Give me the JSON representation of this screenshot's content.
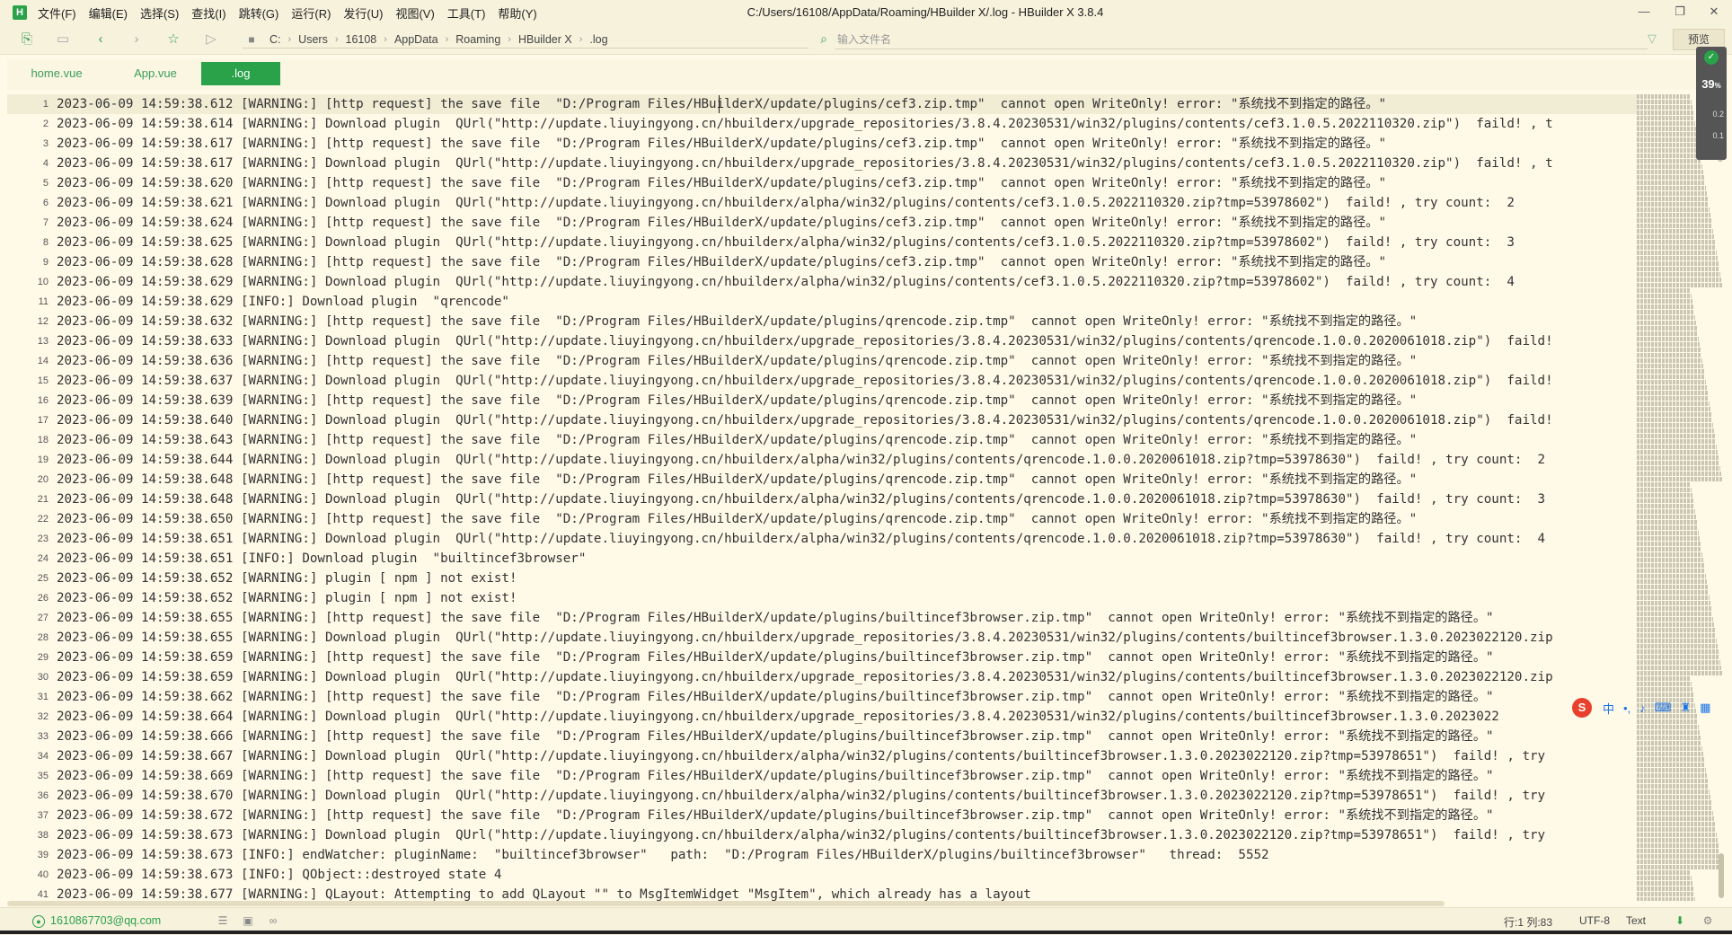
{
  "app": {
    "logo_letter": "H",
    "menu": [
      "文件(F)",
      "编辑(E)",
      "选择(S)",
      "查找(I)",
      "跳转(G)",
      "运行(R)",
      "发行(U)",
      "视图(V)",
      "工具(T)",
      "帮助(Y)"
    ],
    "window_title": "C:/Users/16108/AppData/Roaming/HBuilder X/.log - HBuilder X 3.8.4",
    "window_controls": {
      "minimize": "—",
      "maximize": "❐",
      "close": "✕"
    }
  },
  "toolbar": {
    "breadcrumb": [
      "C:",
      "Users",
      "16108",
      "AppData",
      "Roaming",
      "HBuilder X",
      ".log"
    ],
    "search_placeholder": "输入文件名",
    "preview_label": "预览"
  },
  "tabs": [
    {
      "label": "home.vue",
      "active": false
    },
    {
      "label": "App.vue",
      "active": false
    },
    {
      "label": ".log",
      "active": true
    }
  ],
  "editor": {
    "cursor": {
      "line": 1,
      "col": 83
    },
    "lines": [
      "2023-06-09 14:59:38.612 [WARNING:] [http request] the save file  \"D:/Program Files/HBuilderX/update/plugins/cef3.zip.tmp\"  cannot open WriteOnly! error: \"系统找不到指定的路径。\"",
      "2023-06-09 14:59:38.614 [WARNING:] Download plugin  QUrl(\"http://update.liuyingyong.cn/hbuilderx/upgrade_repositories/3.8.4.20230531/win32/plugins/contents/cef3.1.0.5.2022110320.zip\")  faild! , t",
      "2023-06-09 14:59:38.617 [WARNING:] [http request] the save file  \"D:/Program Files/HBuilderX/update/plugins/cef3.zip.tmp\"  cannot open WriteOnly! error: \"系统找不到指定的路径。\"",
      "2023-06-09 14:59:38.617 [WARNING:] Download plugin  QUrl(\"http://update.liuyingyong.cn/hbuilderx/upgrade_repositories/3.8.4.20230531/win32/plugins/contents/cef3.1.0.5.2022110320.zip\")  faild! , t",
      "2023-06-09 14:59:38.620 [WARNING:] [http request] the save file  \"D:/Program Files/HBuilderX/update/plugins/cef3.zip.tmp\"  cannot open WriteOnly! error: \"系统找不到指定的路径。\"",
      "2023-06-09 14:59:38.621 [WARNING:] Download plugin  QUrl(\"http://update.liuyingyong.cn/hbuilderx/alpha/win32/plugins/contents/cef3.1.0.5.2022110320.zip?tmp=53978602\")  faild! , try count:  2",
      "2023-06-09 14:59:38.624 [WARNING:] [http request] the save file  \"D:/Program Files/HBuilderX/update/plugins/cef3.zip.tmp\"  cannot open WriteOnly! error: \"系统找不到指定的路径。\"",
      "2023-06-09 14:59:38.625 [WARNING:] Download plugin  QUrl(\"http://update.liuyingyong.cn/hbuilderx/alpha/win32/plugins/contents/cef3.1.0.5.2022110320.zip?tmp=53978602\")  faild! , try count:  3",
      "2023-06-09 14:59:38.628 [WARNING:] [http request] the save file  \"D:/Program Files/HBuilderX/update/plugins/cef3.zip.tmp\"  cannot open WriteOnly! error: \"系统找不到指定的路径。\"",
      "2023-06-09 14:59:38.629 [WARNING:] Download plugin  QUrl(\"http://update.liuyingyong.cn/hbuilderx/alpha/win32/plugins/contents/cef3.1.0.5.2022110320.zip?tmp=53978602\")  faild! , try count:  4",
      "2023-06-09 14:59:38.629 [INFO:] Download plugin  \"qrencode\"",
      "2023-06-09 14:59:38.632 [WARNING:] [http request] the save file  \"D:/Program Files/HBuilderX/update/plugins/qrencode.zip.tmp\"  cannot open WriteOnly! error: \"系统找不到指定的路径。\"",
      "2023-06-09 14:59:38.633 [WARNING:] Download plugin  QUrl(\"http://update.liuyingyong.cn/hbuilderx/upgrade_repositories/3.8.4.20230531/win32/plugins/contents/qrencode.1.0.0.2020061018.zip\")  faild!",
      "2023-06-09 14:59:38.636 [WARNING:] [http request] the save file  \"D:/Program Files/HBuilderX/update/plugins/qrencode.zip.tmp\"  cannot open WriteOnly! error: \"系统找不到指定的路径。\"",
      "2023-06-09 14:59:38.637 [WARNING:] Download plugin  QUrl(\"http://update.liuyingyong.cn/hbuilderx/upgrade_repositories/3.8.4.20230531/win32/plugins/contents/qrencode.1.0.0.2020061018.zip\")  faild!",
      "2023-06-09 14:59:38.639 [WARNING:] [http request] the save file  \"D:/Program Files/HBuilderX/update/plugins/qrencode.zip.tmp\"  cannot open WriteOnly! error: \"系统找不到指定的路径。\"",
      "2023-06-09 14:59:38.640 [WARNING:] Download plugin  QUrl(\"http://update.liuyingyong.cn/hbuilderx/upgrade_repositories/3.8.4.20230531/win32/plugins/contents/qrencode.1.0.0.2020061018.zip\")  faild!",
      "2023-06-09 14:59:38.643 [WARNING:] [http request] the save file  \"D:/Program Files/HBuilderX/update/plugins/qrencode.zip.tmp\"  cannot open WriteOnly! error: \"系统找不到指定的路径。\"",
      "2023-06-09 14:59:38.644 [WARNING:] Download plugin  QUrl(\"http://update.liuyingyong.cn/hbuilderx/alpha/win32/plugins/contents/qrencode.1.0.0.2020061018.zip?tmp=53978630\")  faild! , try count:  2",
      "2023-06-09 14:59:38.648 [WARNING:] [http request] the save file  \"D:/Program Files/HBuilderX/update/plugins/qrencode.zip.tmp\"  cannot open WriteOnly! error: \"系统找不到指定的路径。\"",
      "2023-06-09 14:59:38.648 [WARNING:] Download plugin  QUrl(\"http://update.liuyingyong.cn/hbuilderx/alpha/win32/plugins/contents/qrencode.1.0.0.2020061018.zip?tmp=53978630\")  faild! , try count:  3",
      "2023-06-09 14:59:38.650 [WARNING:] [http request] the save file  \"D:/Program Files/HBuilderX/update/plugins/qrencode.zip.tmp\"  cannot open WriteOnly! error: \"系统找不到指定的路径。\"",
      "2023-06-09 14:59:38.651 [WARNING:] Download plugin  QUrl(\"http://update.liuyingyong.cn/hbuilderx/alpha/win32/plugins/contents/qrencode.1.0.0.2020061018.zip?tmp=53978630\")  faild! , try count:  4",
      "2023-06-09 14:59:38.651 [INFO:] Download plugin  \"builtincef3browser\"",
      "2023-06-09 14:59:38.652 [WARNING:] plugin [ npm ] not exist!",
      "2023-06-09 14:59:38.652 [WARNING:] plugin [ npm ] not exist!",
      "2023-06-09 14:59:38.655 [WARNING:] [http request] the save file  \"D:/Program Files/HBuilderX/update/plugins/builtincef3browser.zip.tmp\"  cannot open WriteOnly! error: \"系统找不到指定的路径。\"",
      "2023-06-09 14:59:38.655 [WARNING:] Download plugin  QUrl(\"http://update.liuyingyong.cn/hbuilderx/upgrade_repositories/3.8.4.20230531/win32/plugins/contents/builtincef3browser.1.3.0.2023022120.zip",
      "2023-06-09 14:59:38.659 [WARNING:] [http request] the save file  \"D:/Program Files/HBuilderX/update/plugins/builtincef3browser.zip.tmp\"  cannot open WriteOnly! error: \"系统找不到指定的路径。\"",
      "2023-06-09 14:59:38.659 [WARNING:] Download plugin  QUrl(\"http://update.liuyingyong.cn/hbuilderx/upgrade_repositories/3.8.4.20230531/win32/plugins/contents/builtincef3browser.1.3.0.2023022120.zip",
      "2023-06-09 14:59:38.662 [WARNING:] [http request] the save file  \"D:/Program Files/HBuilderX/update/plugins/builtincef3browser.zip.tmp\"  cannot open WriteOnly! error: \"系统找不到指定的路径。\"",
      "2023-06-09 14:59:38.664 [WARNING:] Download plugin  QUrl(\"http://update.liuyingyong.cn/hbuilderx/upgrade_repositories/3.8.4.20230531/win32/plugins/contents/builtincef3browser.1.3.0.2023022",
      "2023-06-09 14:59:38.666 [WARNING:] [http request] the save file  \"D:/Program Files/HBuilderX/update/plugins/builtincef3browser.zip.tmp\"  cannot open WriteOnly! error: \"系统找不到指定的路径。\"",
      "2023-06-09 14:59:38.667 [WARNING:] Download plugin  QUrl(\"http://update.liuyingyong.cn/hbuilderx/alpha/win32/plugins/contents/builtincef3browser.1.3.0.2023022120.zip?tmp=53978651\")  faild! , try",
      "2023-06-09 14:59:38.669 [WARNING:] [http request] the save file  \"D:/Program Files/HBuilderX/update/plugins/builtincef3browser.zip.tmp\"  cannot open WriteOnly! error: \"系统找不到指定的路径。\"",
      "2023-06-09 14:59:38.670 [WARNING:] Download plugin  QUrl(\"http://update.liuyingyong.cn/hbuilderx/alpha/win32/plugins/contents/builtincef3browser.1.3.0.2023022120.zip?tmp=53978651\")  faild! , try",
      "2023-06-09 14:59:38.672 [WARNING:] [http request] the save file  \"D:/Program Files/HBuilderX/update/plugins/builtincef3browser.zip.tmp\"  cannot open WriteOnly! error: \"系统找不到指定的路径。\"",
      "2023-06-09 14:59:38.673 [WARNING:] Download plugin  QUrl(\"http://update.liuyingyong.cn/hbuilderx/alpha/win32/plugins/contents/builtincef3browser.1.3.0.2023022120.zip?tmp=53978651\")  faild! , try",
      "2023-06-09 14:59:38.673 [INFO:] endWatcher: pluginName:  \"builtincef3browser\"   path:  \"D:/Program Files/HBuilderX/plugins/builtincef3browser\"   thread:  5552",
      "2023-06-09 14:59:38.673 [INFO:] QObject::destroyed state 4",
      "2023-06-09 14:59:38.677 [WARNING:] QLayout: Attempting to add QLayout \"\" to MsgItemWidget \"MsgItem\", which already has a layout"
    ]
  },
  "perf_widget": {
    "percent": "39",
    "percent_unit": "%",
    "upload": "0.2",
    "download": "0.1"
  },
  "ime": {
    "logo": "S",
    "lang": "中",
    "punct": "•,"
  },
  "statusbar": {
    "account": "1610867703@qq.com",
    "position": "行:1  列:83",
    "encoding": "UTF-8",
    "syntax": "Text"
  },
  "colors": {
    "accent": "#2aa24a",
    "background": "#fffae8",
    "toolbar": "#f7f2dc"
  }
}
